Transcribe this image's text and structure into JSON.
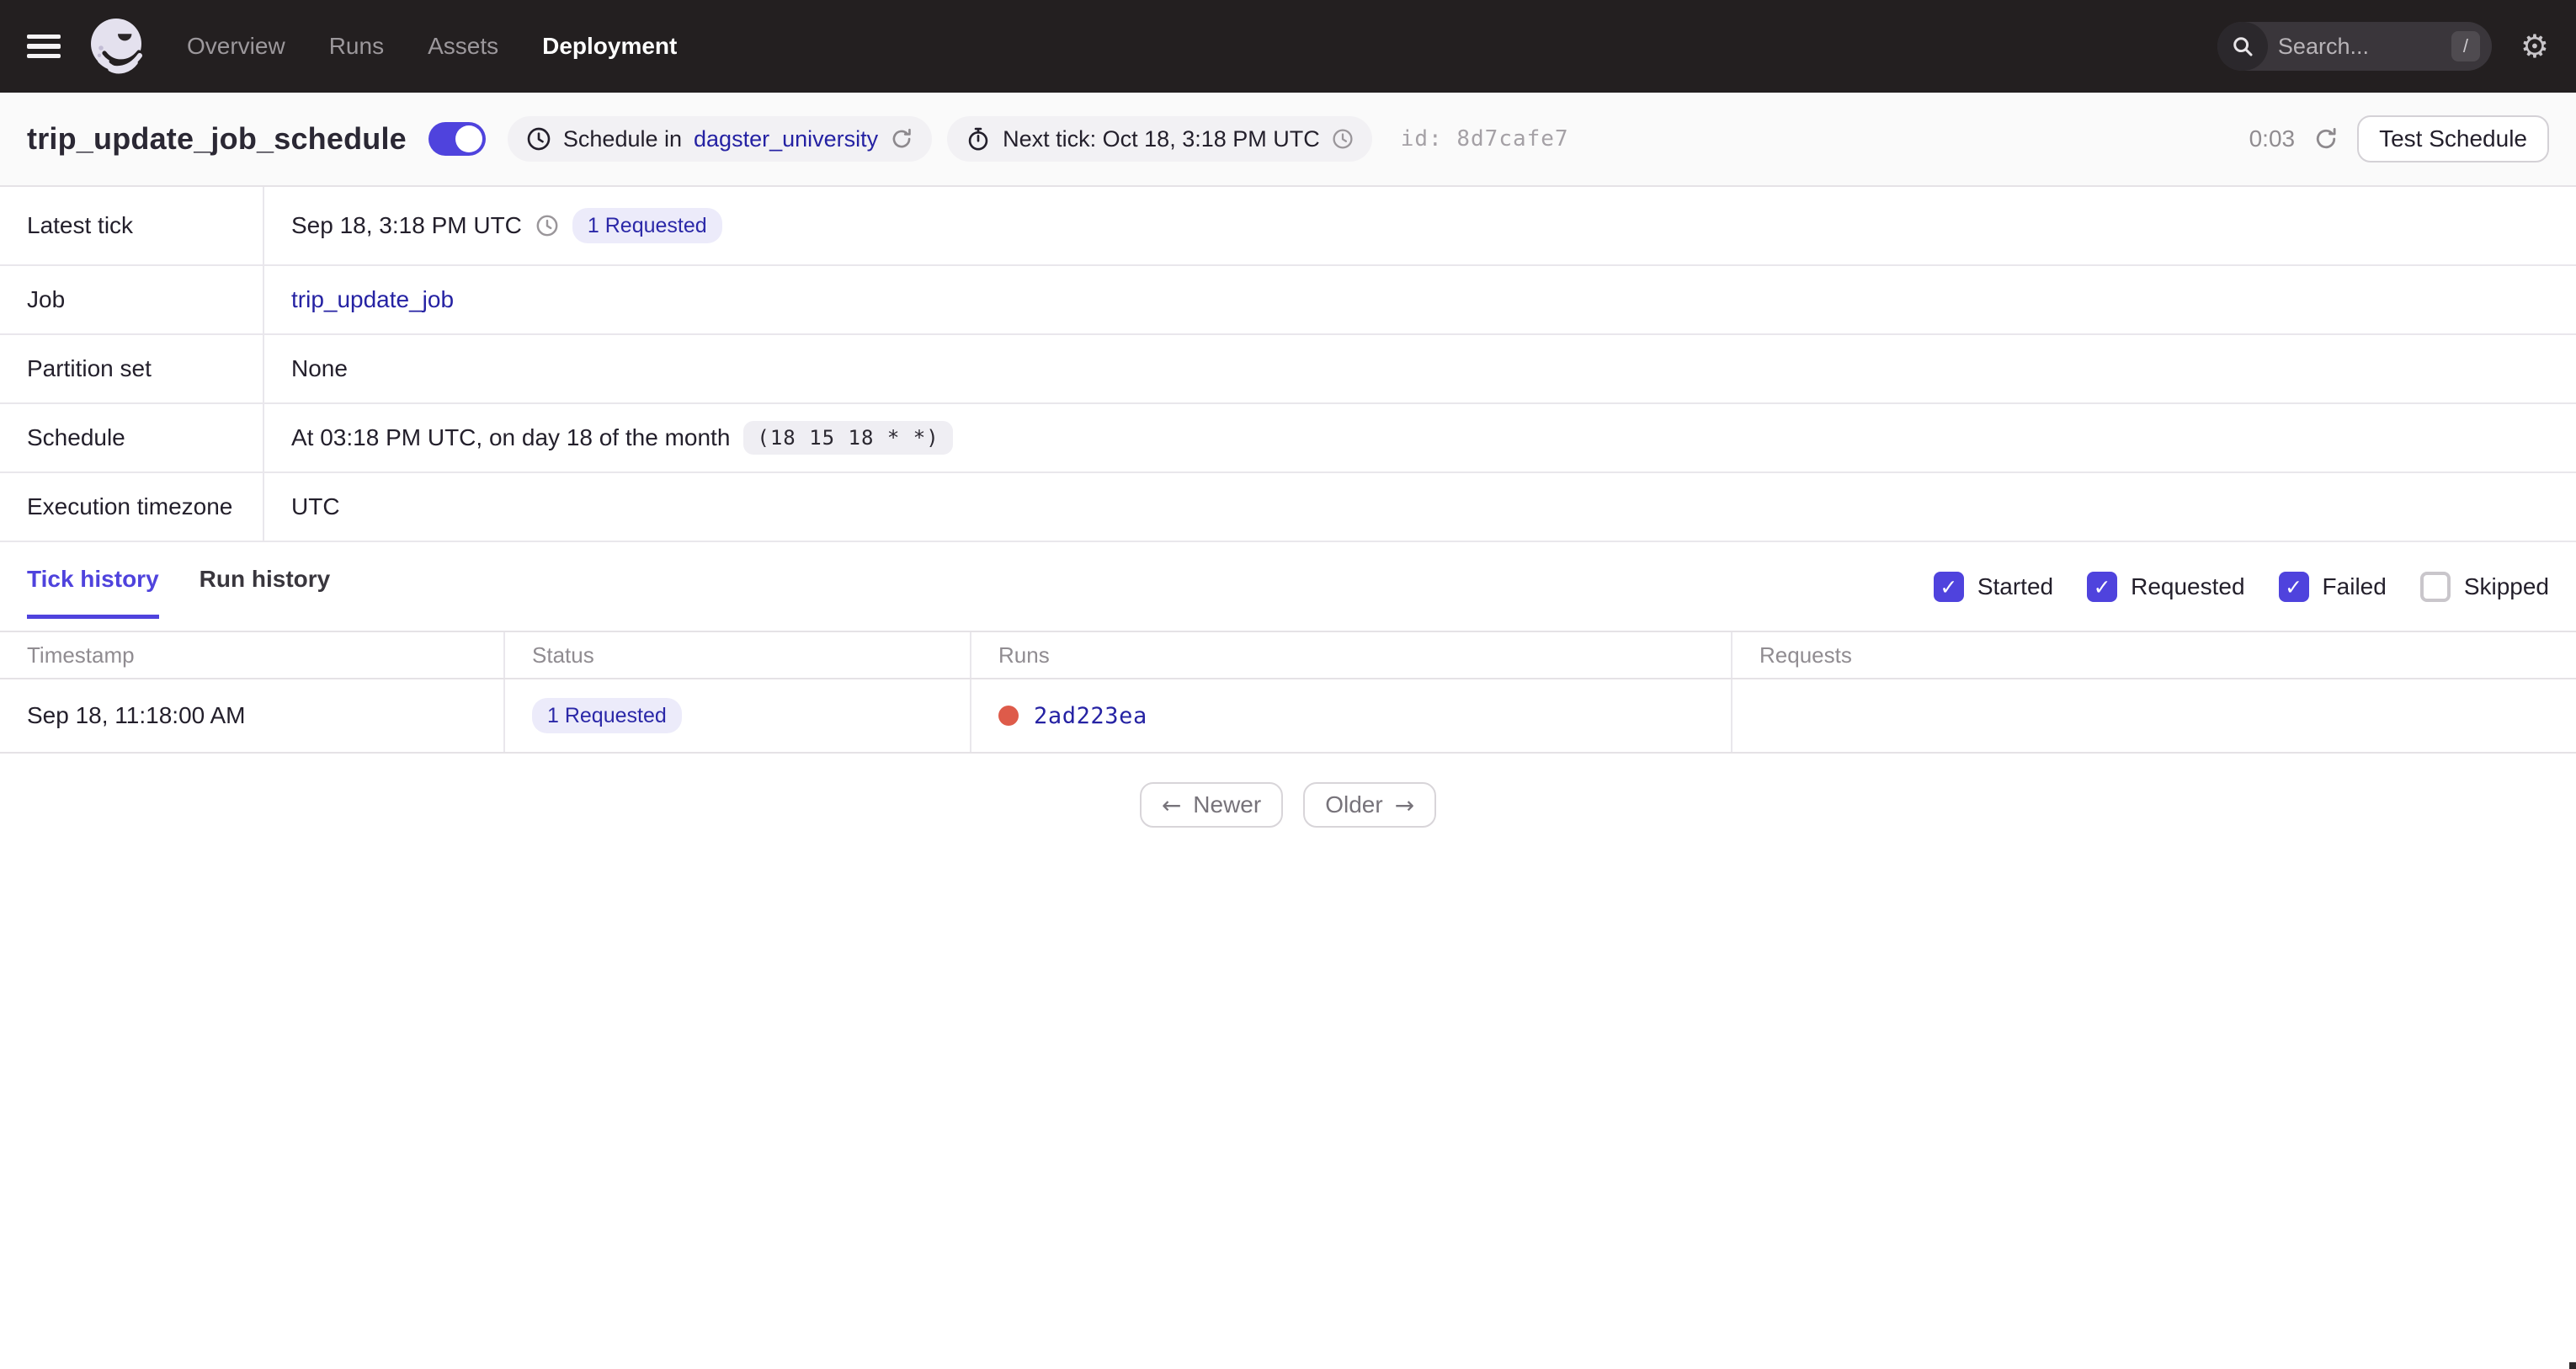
{
  "nav": {
    "items": [
      {
        "label": "Overview",
        "active": false
      },
      {
        "label": "Runs",
        "active": false
      },
      {
        "label": "Assets",
        "active": false
      },
      {
        "label": "Deployment",
        "active": true
      }
    ],
    "search": {
      "placeholder": "Search...",
      "shortcut": "/"
    }
  },
  "icons": {
    "gear": "⚙",
    "check": "✓",
    "arrow_left": "←",
    "arrow_right": "→"
  },
  "title_bar": {
    "title": "trip_update_job_schedule",
    "toggle_on": true,
    "schedule_badge": {
      "prefix": "Schedule in",
      "repo_link": "dagster_university"
    },
    "next_tick_badge": "Next tick: Oct 18, 3:18 PM UTC",
    "id_text": "id: 8d7cafe7",
    "countdown": "0:03",
    "test_button": "Test Schedule"
  },
  "details": {
    "rows": [
      {
        "label": "Latest tick",
        "value": "Sep 18, 3:18 PM UTC",
        "badge": "1 Requested"
      },
      {
        "label": "Job",
        "link": "trip_update_job"
      },
      {
        "label": "Partition set",
        "value": "None"
      },
      {
        "label": "Schedule",
        "value": "At 03:18 PM UTC, on day 18 of the month",
        "cron": "(18 15 18 * *)"
      },
      {
        "label": "Execution timezone",
        "value": "UTC"
      }
    ]
  },
  "tabs": [
    {
      "label": "Tick history",
      "active": true
    },
    {
      "label": "Run history",
      "active": false
    }
  ],
  "filters": [
    {
      "label": "Started",
      "checked": true
    },
    {
      "label": "Requested",
      "checked": true
    },
    {
      "label": "Failed",
      "checked": true
    },
    {
      "label": "Skipped",
      "checked": false
    }
  ],
  "tick_table": {
    "headers": [
      "Timestamp",
      "Status",
      "Runs",
      "Requests"
    ],
    "rows": [
      {
        "timestamp": "Sep 18, 11:18:00 AM",
        "status": "1 Requested",
        "run_id": "2ad223ea",
        "run_status": "failed"
      }
    ]
  },
  "pagination": {
    "newer": "Newer",
    "older": "Older"
  },
  "colors": {
    "nav_bg": "#231f20",
    "accent": "#4f43dd",
    "link": "#2522a3",
    "status_badge_bg": "#ecebfa",
    "status_badge_text": "#2b28a8",
    "failed_dot": "#de5b4a",
    "titlebar_bg": "#fafafa",
    "border": "#e5e2e6"
  }
}
